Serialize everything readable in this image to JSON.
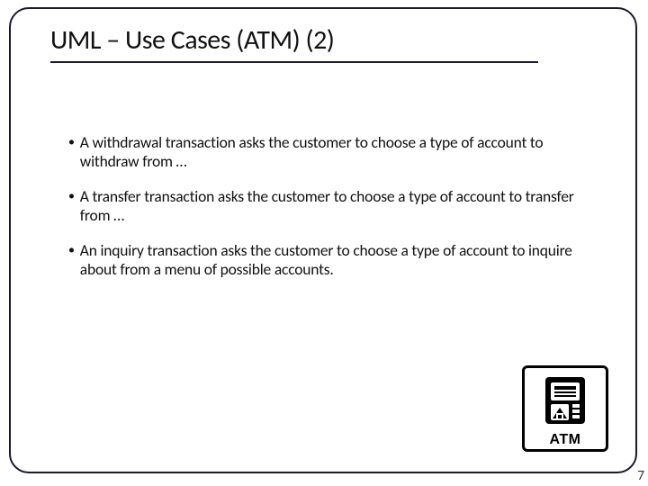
{
  "slide": {
    "title": "UML – Use Cases (ATM) (2)",
    "bullets": [
      "A withdrawal transaction asks the customer to choose a type of account to withdraw from …",
      "A transfer transaction asks the customer to choose a type of account to transfer from …",
      "An inquiry transaction asks the customer to choose a type of account to inquire about from a menu of possible accounts."
    ],
    "icon_label": "ATM",
    "page_number": "7"
  }
}
